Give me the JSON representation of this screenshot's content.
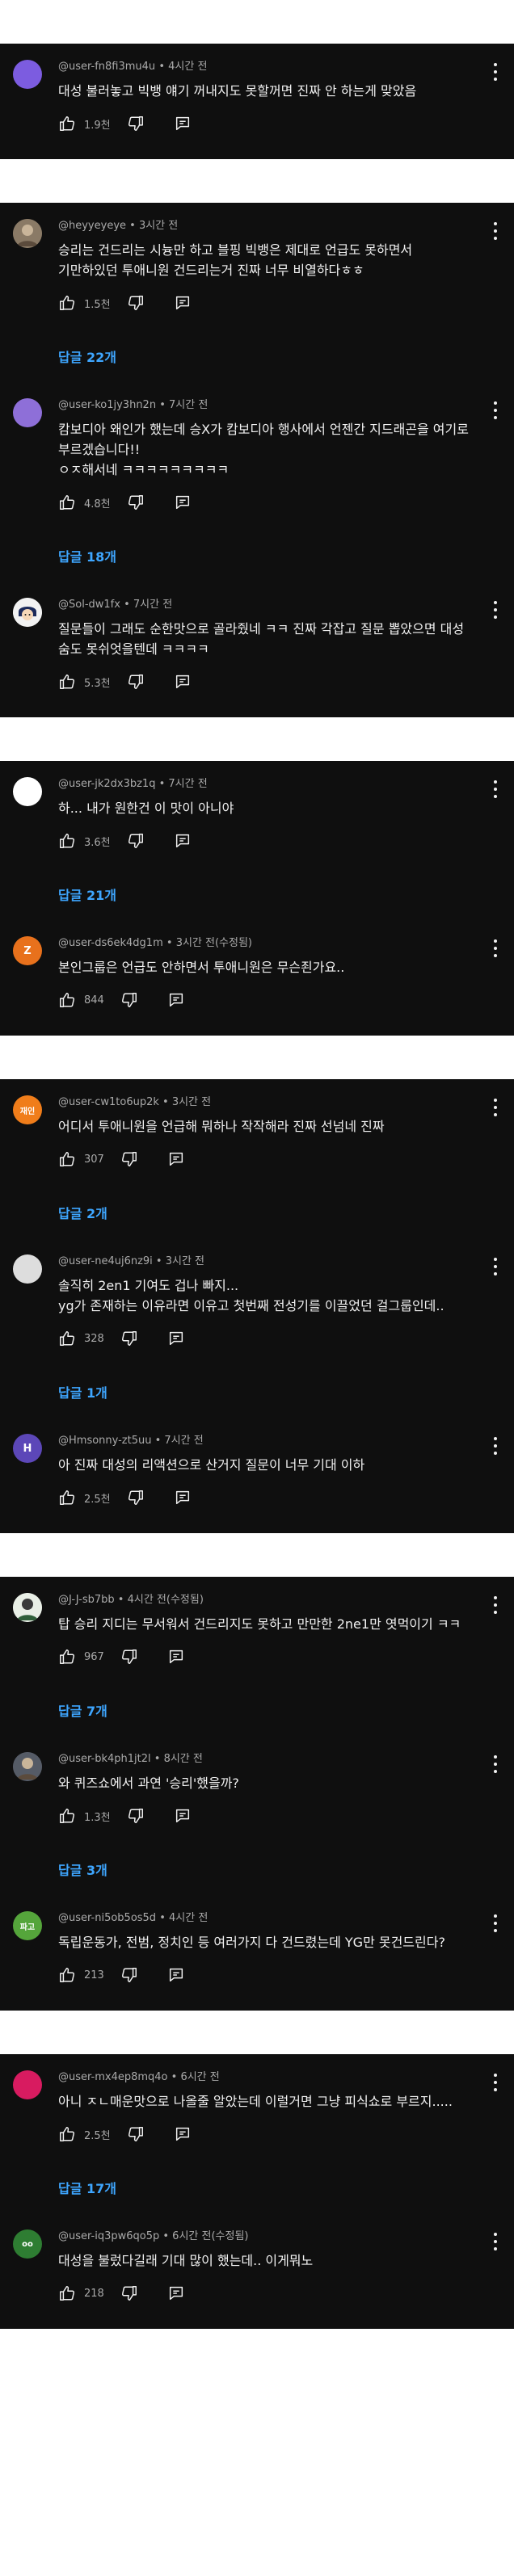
{
  "cards": [
    {
      "comments": [
        {
          "user": "@user-fn8fi3mu4u",
          "time": "4시간 전",
          "text": "대성 불러놓고 빅뱅 얘기 꺼내지도 못할꺼면 진짜 안 하는게 맞았음",
          "likes": "1.9천",
          "avatar": {
            "bg": "#7c5ce0",
            "letter": "",
            "style": "dot"
          }
        }
      ]
    },
    {
      "comments": [
        {
          "user": "@heyyeyeye",
          "time": "3시간 전",
          "text": "승리는 건드리는 시늉만 하고 블핑 빅뱅은 제대로 언급도 못하면서 기만하있던 투애니원 건드리는거 진짜 너무 비열하다ㅎㅎ",
          "likes": "1.5천",
          "replies": "답글 22개",
          "avatar": {
            "bg": "#8a7a66",
            "letter": "",
            "style": "photo"
          }
        },
        {
          "user": "@user-ko1jy3hn2n",
          "time": "7시간 전",
          "text": "캄보디아 왜인가 했는데 승X가 캄보디아 행사에서 언젠간 지드래곤을 여기로 부르겠습니다!!\nㅇㅈ해서네 ㅋㅋㅋㅋㅋㅋㅋㅋㅋ",
          "likes": "4.8천",
          "replies": "답글 18개",
          "avatar": {
            "bg": "#8e6fd8",
            "letter": "",
            "style": "dot"
          }
        },
        {
          "user": "@Sol-dw1fx",
          "time": "7시간 전",
          "text": "질문들이 그래도 순한맛으로 골라줬네 ㅋㅋ 진짜 각잡고 질문 뽑았으면 대성 숨도 못쉬엇을텐데 ㅋㅋㅋㅋ",
          "likes": "5.3천",
          "avatar": {
            "bg": "#f2f2f2",
            "letter": "",
            "style": "face"
          }
        }
      ]
    },
    {
      "comments": [
        {
          "user": "@user-jk2dx3bz1q",
          "time": "7시간 전",
          "text": "하... 내가 원한건 이 맛이 아니야",
          "likes": "3.6천",
          "replies": "답글 21개",
          "avatar": {
            "bg": "#ffffff",
            "letter": "",
            "style": "plain"
          }
        },
        {
          "user": "@user-ds6ek4dg1m",
          "time": "3시간 전(수정됨)",
          "text": "본인그룹은 언급도 안하면서 투애니원은 무슨죈가요..",
          "likes": "844",
          "avatar": {
            "bg": "#e8711c",
            "letter": "Z",
            "style": "letter"
          }
        }
      ]
    },
    {
      "comments": [
        {
          "user": "@user-cw1to6up2k",
          "time": "3시간 전",
          "text": "어디서 투애니원을 언급해 뭐하나 작작해라 진짜 선넘네 진짜",
          "likes": "307",
          "replies": "답글 2개",
          "avatar": {
            "bg": "#f07d1a",
            "letter": "재인",
            "style": "letter"
          }
        },
        {
          "user": "@user-ne4uj6nz9i",
          "time": "3시간 전",
          "text": "솔직히 2en1 기여도 겁나 빠지...\nyg가 존재하는 이유라면 이유고 첫번째 전성기를 이끌었던 걸그룹인데..",
          "likes": "328",
          "replies": "답글 1개",
          "avatar": {
            "bg": "#dddddd",
            "letter": "",
            "style": "plain"
          }
        },
        {
          "user": "@Hmsonny-zt5uu",
          "time": "7시간 전",
          "text": "아 진짜 대성의 리액션으로 산거지 질문이 너무 기대 이하",
          "likes": "2.5천",
          "avatar": {
            "bg": "#5c47b8",
            "letter": "H",
            "style": "letter"
          }
        }
      ]
    },
    {
      "comments": [
        {
          "user": "@J-J-sb7bb",
          "time": "4시간 전(수정됨)",
          "text": "탑 승리 지디는 무서워서 건드리지도 못하고 만만한 2ne1만 엿먹이기 ㅋㅋ",
          "likes": "967",
          "replies": "답글 7개",
          "avatar": {
            "bg": "#e9efe6",
            "letter": "",
            "style": "photo2"
          }
        },
        {
          "user": "@user-bk4ph1jt2l",
          "time": "8시간 전",
          "text": "와 퀴즈쇼에서 과연 '승리'했을까?",
          "likes": "1.3천",
          "replies": "답글 3개",
          "avatar": {
            "bg": "#555b66",
            "letter": "",
            "style": "photo"
          }
        },
        {
          "user": "@user-ni5ob5os5d",
          "time": "4시간 전",
          "text": "독립운동가, 전범, 정치인 등 여러가지 다 건드렸는데 YG만 못건드린다?",
          "likes": "213",
          "avatar": {
            "bg": "#55a53b",
            "letter": "파고",
            "style": "letter"
          }
        }
      ]
    },
    {
      "comments": [
        {
          "user": "@user-mx4ep8mq4o",
          "time": "6시간 전",
          "text": "아니 ㅈㄴ매운맛으로 나올줄 알았는데 이럴거면 그냥 피식쇼로 부르지.....",
          "likes": "2.5천",
          "replies": "답글 17개",
          "avatar": {
            "bg": "#d81b60",
            "letter": "",
            "style": "dot"
          }
        },
        {
          "user": "@user-iq3pw6qo5p",
          "time": "6시간 전(수정됨)",
          "text": "대성을 불렀다길래 기대 많이 했는데.. 이게뭐노",
          "likes": "218",
          "avatar": {
            "bg": "#2e7d32",
            "letter": "oo",
            "style": "letter"
          }
        }
      ]
    }
  ],
  "icons": {
    "like": "thumbs-up-icon",
    "dislike": "thumbs-down-icon",
    "reply": "reply-icon",
    "more": "more-vert-icon"
  }
}
